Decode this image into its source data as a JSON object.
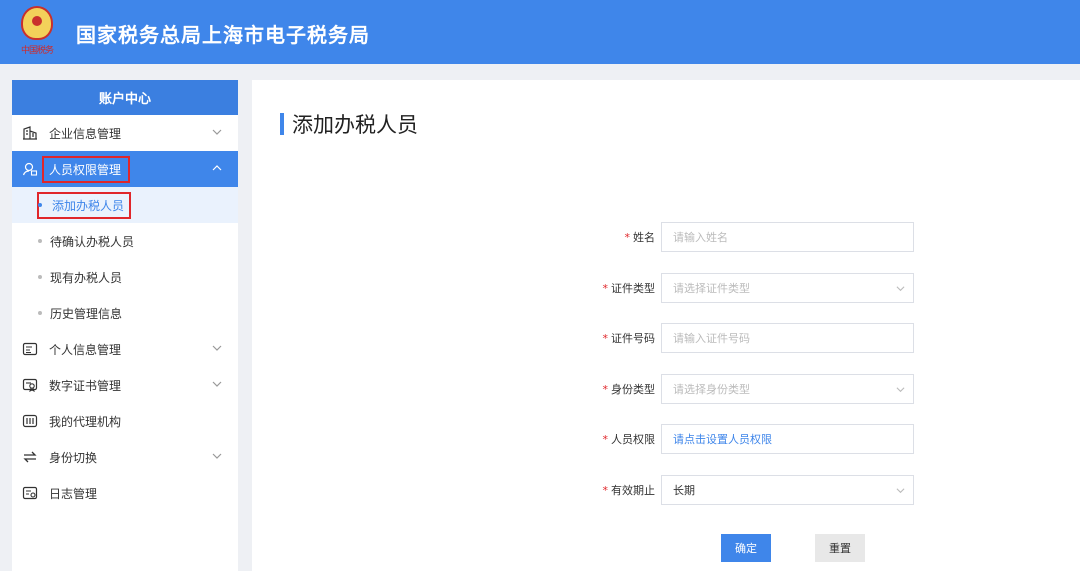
{
  "header": {
    "title": "国家税务总局上海市电子税务局",
    "emblem_text": "中国税务"
  },
  "sidebar": {
    "title": "账户中心",
    "items": [
      {
        "label": "企业信息管理",
        "icon": "building-icon",
        "expandable": true
      },
      {
        "label": "人员权限管理",
        "icon": "user-lock-icon",
        "expandable": true,
        "expanded": true,
        "children": [
          {
            "label": "添加办税人员",
            "selected": true
          },
          {
            "label": "待确认办税人员"
          },
          {
            "label": "现有办税人员"
          },
          {
            "label": "历史管理信息"
          }
        ]
      },
      {
        "label": "个人信息管理",
        "icon": "id-card-icon",
        "expandable": true
      },
      {
        "label": "数字证书管理",
        "icon": "certificate-icon",
        "expandable": true
      },
      {
        "label": "我的代理机构",
        "icon": "agency-icon",
        "expandable": false
      },
      {
        "label": "身份切换",
        "icon": "switch-icon",
        "expandable": true
      },
      {
        "label": "日志管理",
        "icon": "log-icon",
        "expandable": false
      }
    ]
  },
  "main": {
    "title": "添加办税人员",
    "form": {
      "name": {
        "label": "姓名",
        "placeholder": "请输入姓名"
      },
      "id_type": {
        "label": "证件类型",
        "placeholder": "请选择证件类型"
      },
      "id_number": {
        "label": "证件号码",
        "placeholder": "请输入证件号码"
      },
      "identity_type": {
        "label": "身份类型",
        "placeholder": "请选择身份类型"
      },
      "permission": {
        "label": "人员权限",
        "value": "请点击设置人员权限"
      },
      "validity": {
        "label": "有效期止",
        "value": "长期"
      }
    },
    "buttons": {
      "confirm": "确定",
      "reset": "重置"
    }
  },
  "colors": {
    "primary": "#3f86ea",
    "required": "#e0262a",
    "highlight_box": "#e0262a"
  }
}
